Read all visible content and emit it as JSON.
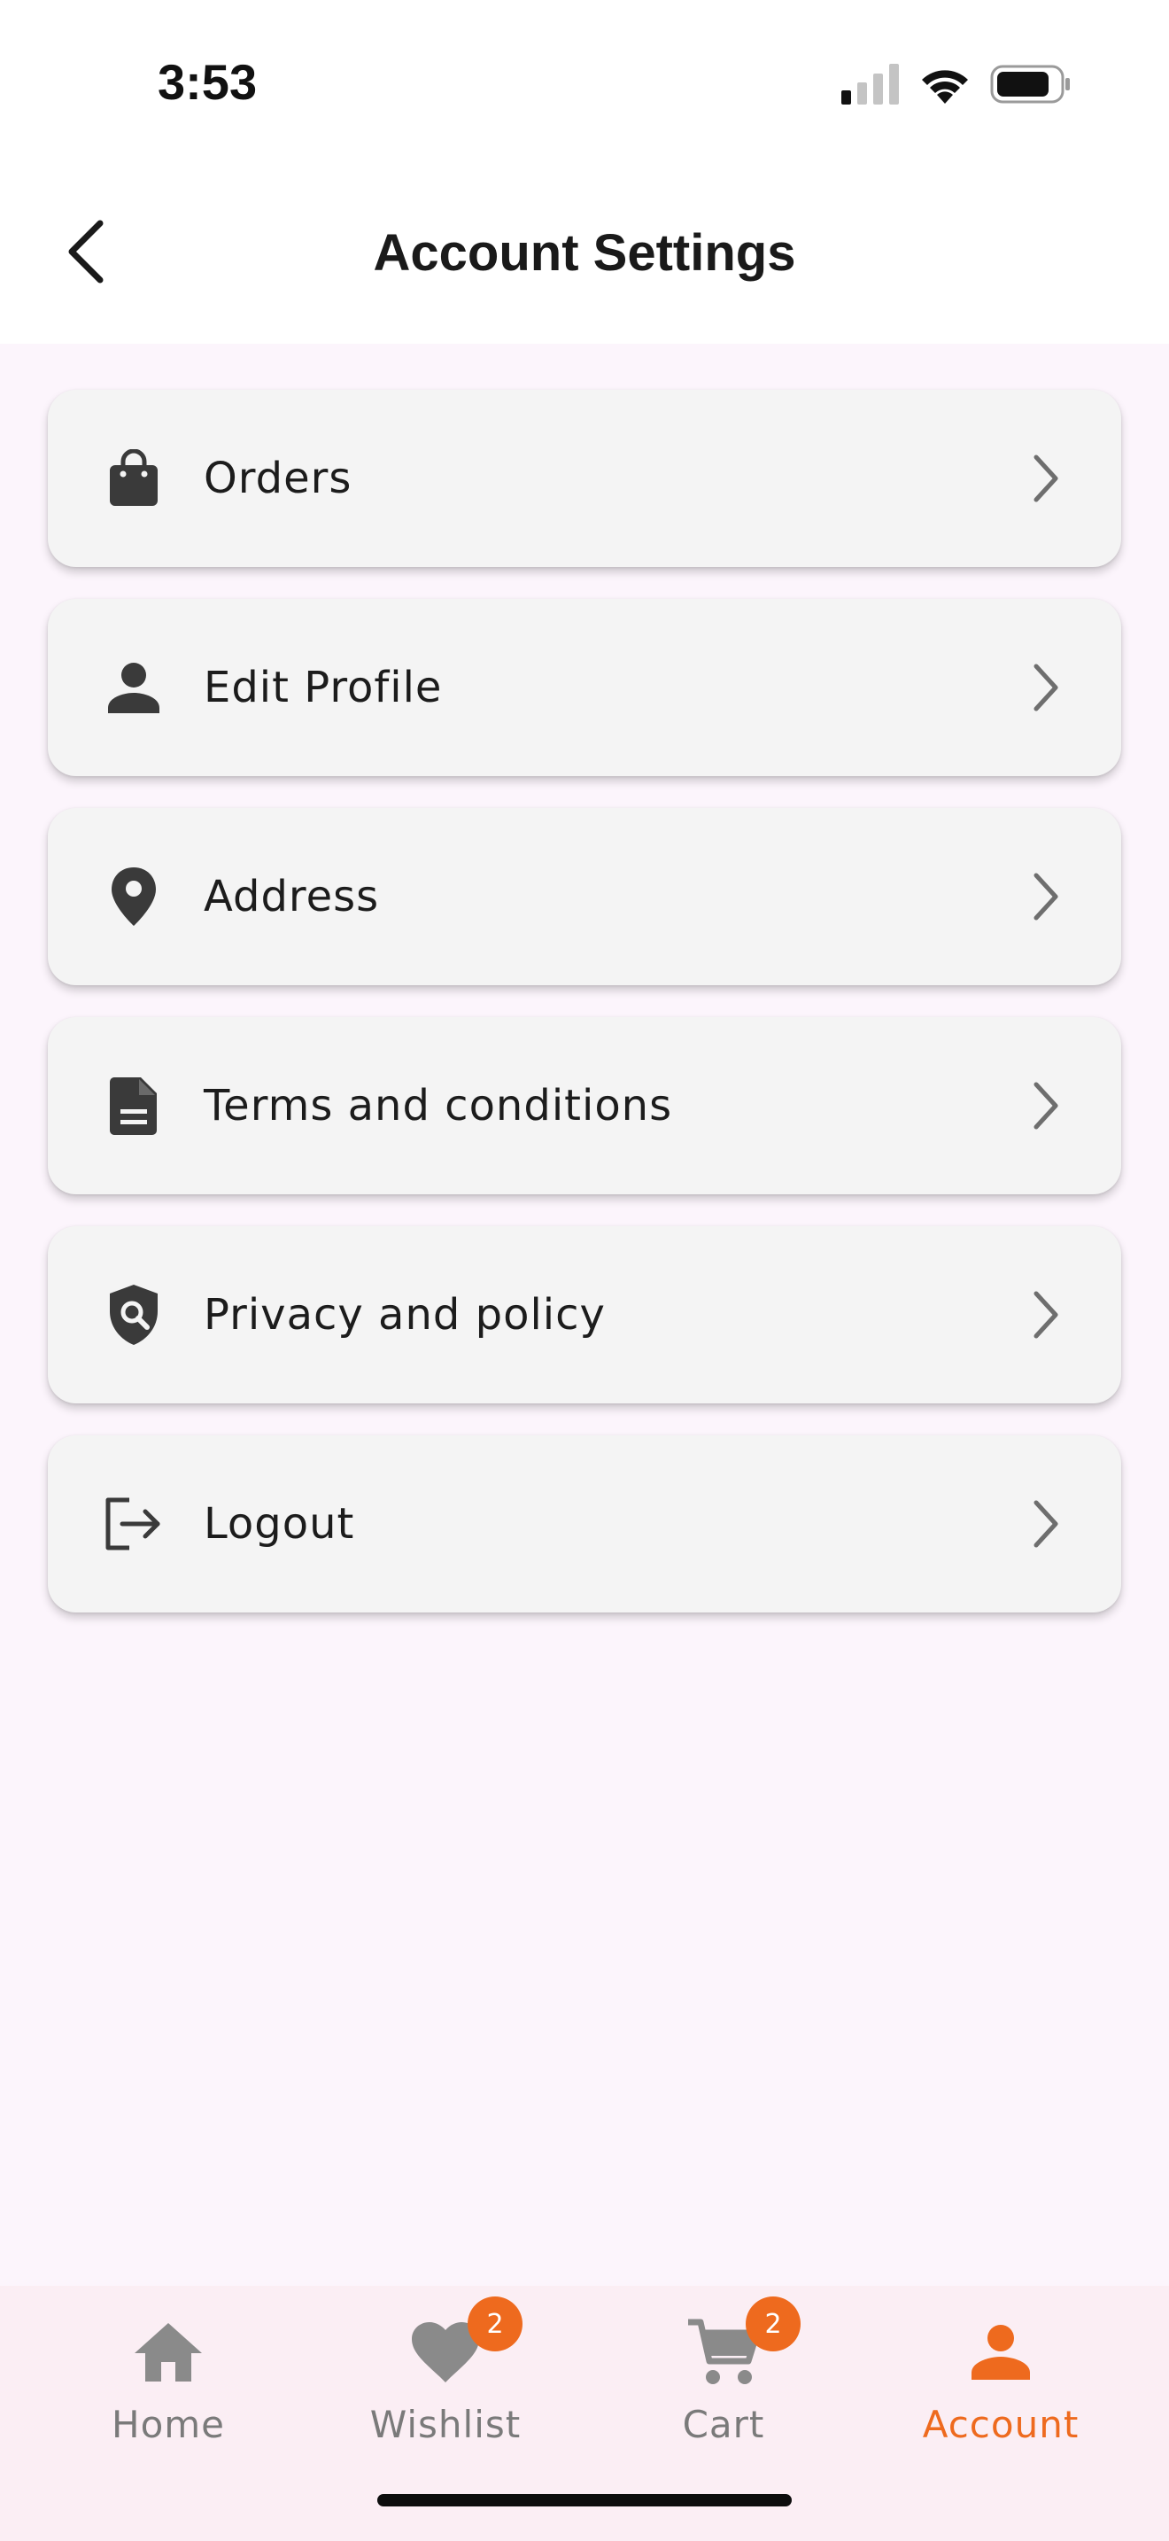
{
  "status_bar": {
    "time": "3:53"
  },
  "header": {
    "title": "Account Settings"
  },
  "menu": {
    "items": [
      {
        "label": "Orders",
        "icon": "shopping-bag-icon"
      },
      {
        "label": "Edit Profile",
        "icon": "person-icon"
      },
      {
        "label": "Address",
        "icon": "location-pin-icon"
      },
      {
        "label": "Terms and conditions",
        "icon": "document-icon"
      },
      {
        "label": "Privacy and policy",
        "icon": "privacy-shield-icon"
      },
      {
        "label": "Logout",
        "icon": "logout-icon"
      }
    ]
  },
  "bottom_nav": {
    "items": [
      {
        "label": "Home",
        "icon": "home-icon",
        "active": false
      },
      {
        "label": "Wishlist",
        "icon": "heart-icon",
        "badge": "2",
        "active": false
      },
      {
        "label": "Cart",
        "icon": "cart-icon",
        "badge": "2",
        "active": false
      },
      {
        "label": "Account",
        "icon": "account-icon",
        "active": true
      }
    ]
  },
  "colors": {
    "accent": "#ee6a1e",
    "background": "#fcf5fc",
    "card": "#f4f4f4",
    "icon": "#3a3a3a",
    "inactive_nav": "#7a7a7a"
  }
}
